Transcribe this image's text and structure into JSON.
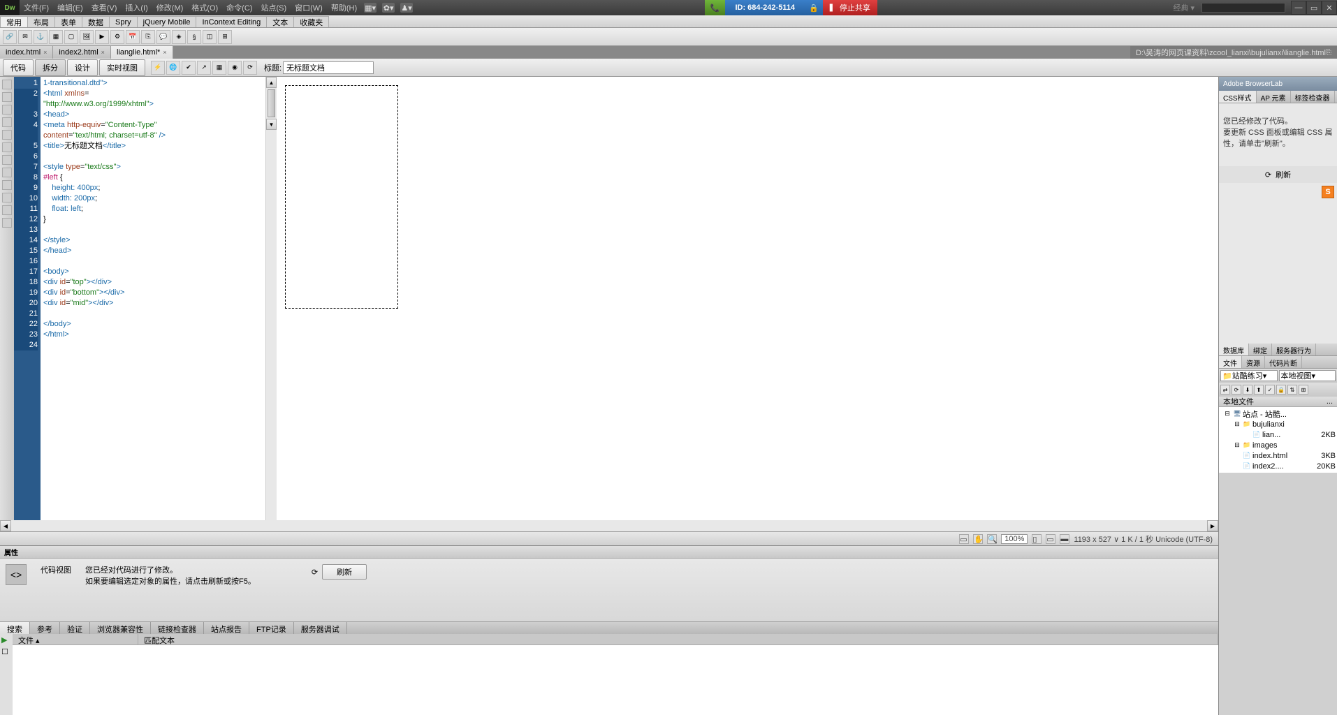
{
  "menubar": {
    "items": [
      "文件(F)",
      "编辑(E)",
      "查看(V)",
      "插入(I)",
      "修改(M)",
      "格式(O)",
      "命令(C)",
      "站点(S)",
      "窗口(W)",
      "帮助(H)"
    ],
    "classic": "经典 ▾"
  },
  "teamviewer": {
    "id": "ID: 684-242-5114",
    "stop": "▍ 停止共享"
  },
  "insertbar": {
    "tabs": [
      "常用",
      "布局",
      "表单",
      "数据",
      "Spry",
      "jQuery Mobile",
      "InContext Editing",
      "文本",
      "收藏夹"
    ]
  },
  "doc_tabs": [
    {
      "label": "index.html",
      "active": false
    },
    {
      "label": "index2.html",
      "active": false
    },
    {
      "label": "lianglie.html*",
      "active": true
    }
  ],
  "doc_path": "D:\\吴涛的网页课资料\\zcool_lianxi\\bujulianxi\\lianglie.html",
  "view_buttons": {
    "code": "代码",
    "split": "拆分",
    "design": "设计",
    "live": "实时视图"
  },
  "title_label": "标题:",
  "title_value": "无标题文档",
  "code_lines": [
    {
      "n": 1,
      "html": "<span class='tag'>1-transitional.dtd\"&gt;</span>"
    },
    {
      "n": 2,
      "html": "<span class='tag'>&lt;html</span> <span class='attr'>xmlns</span>="
    },
    {
      "n": 0,
      "html": "<span class='str'>\"http://www.w3.org/1999/xhtml\"</span><span class='tag'>&gt;</span>"
    },
    {
      "n": 3,
      "html": "<span class='tag'>&lt;head&gt;</span>"
    },
    {
      "n": 4,
      "html": "<span class='tag'>&lt;meta</span> <span class='attr'>http-equiv</span>=<span class='str'>\"Content-Type\"</span>"
    },
    {
      "n": 0,
      "html": "<span class='attr'>content</span>=<span class='str'>\"text/html; charset=utf-8\"</span> <span class='tag'>/&gt;</span>"
    },
    {
      "n": 5,
      "html": "<span class='tag'>&lt;title&gt;</span>无标题文档<span class='tag'>&lt;/title&gt;</span>"
    },
    {
      "n": 6,
      "html": ""
    },
    {
      "n": 7,
      "html": "<span class='tag'>&lt;style</span> <span class='attr'>type</span>=<span class='str'>\"text/css\"</span><span class='tag'>&gt;</span>"
    },
    {
      "n": 8,
      "html": "<span class='css-sel'>#left</span> {"
    },
    {
      "n": 9,
      "html": "    <span class='css-prop'>height:</span> <span class='css-val'>400px</span>;"
    },
    {
      "n": 10,
      "html": "    <span class='css-prop'>width:</span> <span class='css-val'>200px</span>;"
    },
    {
      "n": 11,
      "html": "    <span class='css-prop'>float:</span> <span class='css-val'>left</span>;"
    },
    {
      "n": 12,
      "html": "}"
    },
    {
      "n": 13,
      "html": ""
    },
    {
      "n": 14,
      "html": "<span class='tag'>&lt;/style&gt;</span>"
    },
    {
      "n": 15,
      "html": "<span class='tag'>&lt;/head&gt;</span>"
    },
    {
      "n": 16,
      "html": ""
    },
    {
      "n": 17,
      "html": "<span class='tag'>&lt;body&gt;</span>"
    },
    {
      "n": 18,
      "html": "<span class='tag'>&lt;div</span> <span class='attr'>id</span>=<span class='str'>\"top\"</span><span class='tag'>&gt;&lt;/div&gt;</span>"
    },
    {
      "n": 19,
      "html": "<span class='tag'>&lt;div</span> <span class='attr'>id</span>=<span class='str'>\"bottom\"</span><span class='tag'>&gt;&lt;/div&gt;</span>"
    },
    {
      "n": 20,
      "html": "<span class='tag'>&lt;div</span> <span class='attr'>id</span>=<span class='str'>\"mid\"</span><span class='tag'>&gt;&lt;/div&gt;</span>"
    },
    {
      "n": 21,
      "html": ""
    },
    {
      "n": 22,
      "html": "<span class='tag'>&lt;/body&gt;</span>"
    },
    {
      "n": 23,
      "html": "<span class='tag'>&lt;/html&gt;</span>"
    },
    {
      "n": 24,
      "html": ""
    }
  ],
  "statusbar": {
    "zoom": "100%",
    "info": "1193 x 527 ∨ 1 K / 1 秒 Unicode (UTF-8)"
  },
  "properties": {
    "title": "属性",
    "code_view": "代码视图",
    "msg1": "您已经对代码进行了修改。",
    "msg2": "如果要编辑选定对象的属性，请点击刷新或按F5。",
    "refresh": "刷新"
  },
  "bottom_tabs": [
    "搜索",
    "参考",
    "验证",
    "浏览器兼容性",
    "链接检查器",
    "站点报告",
    "FTP记录",
    "服务器调试"
  ],
  "result_cols": {
    "file": "文件",
    "match": "匹配文本"
  },
  "right": {
    "browserlab": "Adobe BrowserLab",
    "css_tabs": [
      "CSS样式",
      "AP 元素",
      "标签检查器"
    ],
    "css_msg": "您已经修改了代码。\n要更新 CSS 面板或编辑 CSS 属性，请单击\"刷新\"。",
    "refresh": "刷新",
    "mid_tabs": [
      "数据库",
      "绑定",
      "服务器行为"
    ],
    "files_tabs": [
      "文件",
      "资源",
      "代码片断"
    ],
    "site_dd": "站酷练习",
    "view_dd": "本地视图",
    "local_files": "本地文件",
    "tree": [
      {
        "indent": 0,
        "icon": "site",
        "label": "站点 - 站酷...",
        "size": ""
      },
      {
        "indent": 1,
        "icon": "folder",
        "label": "bujulianxi",
        "size": ""
      },
      {
        "indent": 2,
        "icon": "file",
        "label": "lian...",
        "size": "2KB"
      },
      {
        "indent": 1,
        "icon": "folder",
        "label": "images",
        "size": ""
      },
      {
        "indent": 1,
        "icon": "file",
        "label": "index.html",
        "size": "3KB"
      },
      {
        "indent": 1,
        "icon": "file",
        "label": "index2....",
        "size": "20KB"
      }
    ]
  }
}
